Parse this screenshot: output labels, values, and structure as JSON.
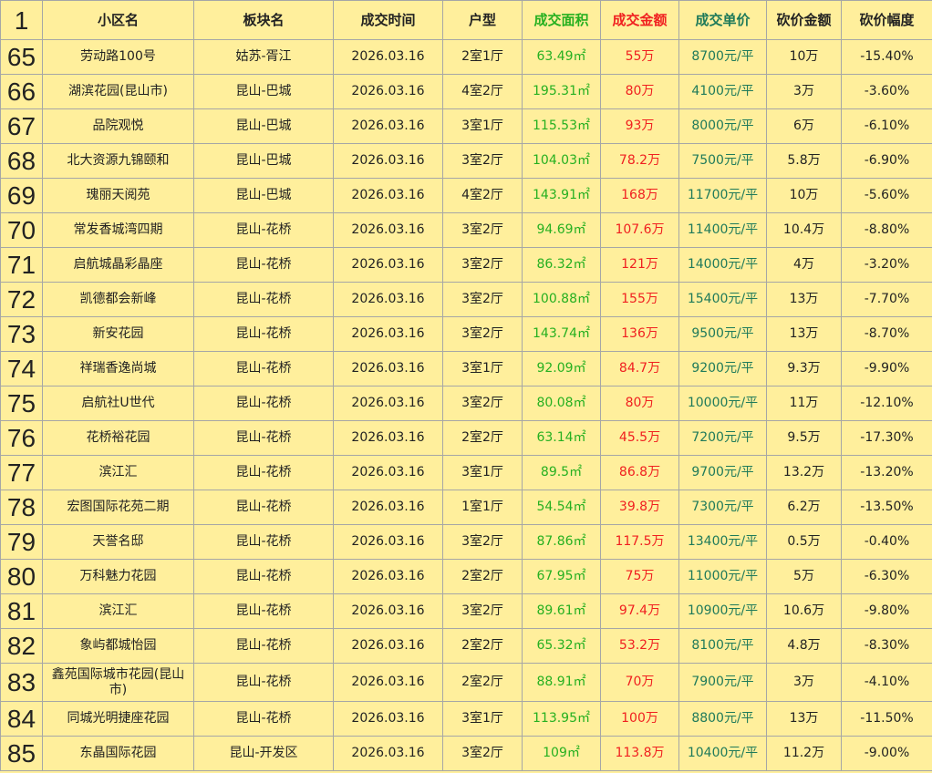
{
  "header": {
    "row_number": "1",
    "columns": [
      "小区名",
      "板块名",
      "成交时间",
      "户型",
      "成交面积",
      "成交金额",
      "成交单价",
      "砍价金额",
      "砍价幅度"
    ]
  },
  "rows": [
    {
      "n": "65",
      "name": "劳动路100号",
      "area": "姑苏-胥江",
      "date": "2026.03.16",
      "layout": "2室1厅",
      "size": "63.49㎡",
      "price": "55万",
      "unit": "8700元/平",
      "cut": "10万",
      "pct": "-15.40%"
    },
    {
      "n": "66",
      "name": "湖滨花园(昆山市)",
      "area": "昆山-巴城",
      "date": "2026.03.16",
      "layout": "4室2厅",
      "size": "195.31㎡",
      "price": "80万",
      "unit": "4100元/平",
      "cut": "3万",
      "pct": "-3.60%"
    },
    {
      "n": "67",
      "name": "品院观悦",
      "area": "昆山-巴城",
      "date": "2026.03.16",
      "layout": "3室1厅",
      "size": "115.53㎡",
      "price": "93万",
      "unit": "8000元/平",
      "cut": "6万",
      "pct": "-6.10%"
    },
    {
      "n": "68",
      "name": "北大资源九锦颐和",
      "area": "昆山-巴城",
      "date": "2026.03.16",
      "layout": "3室2厅",
      "size": "104.03㎡",
      "price": "78.2万",
      "unit": "7500元/平",
      "cut": "5.8万",
      "pct": "-6.90%"
    },
    {
      "n": "69",
      "name": "瑰丽天阅苑",
      "area": "昆山-巴城",
      "date": "2026.03.16",
      "layout": "4室2厅",
      "size": "143.91㎡",
      "price": "168万",
      "unit": "11700元/平",
      "cut": "10万",
      "pct": "-5.60%"
    },
    {
      "n": "70",
      "name": "常发香城湾四期",
      "area": "昆山-花桥",
      "date": "2026.03.16",
      "layout": "3室2厅",
      "size": "94.69㎡",
      "price": "107.6万",
      "unit": "11400元/平",
      "cut": "10.4万",
      "pct": "-8.80%"
    },
    {
      "n": "71",
      "name": "启航城晶彩晶座",
      "area": "昆山-花桥",
      "date": "2026.03.16",
      "layout": "3室2厅",
      "size": "86.32㎡",
      "price": "121万",
      "unit": "14000元/平",
      "cut": "4万",
      "pct": "-3.20%"
    },
    {
      "n": "72",
      "name": "凯德都会新峰",
      "area": "昆山-花桥",
      "date": "2026.03.16",
      "layout": "3室2厅",
      "size": "100.88㎡",
      "price": "155万",
      "unit": "15400元/平",
      "cut": "13万",
      "pct": "-7.70%"
    },
    {
      "n": "73",
      "name": "新安花园",
      "area": "昆山-花桥",
      "date": "2026.03.16",
      "layout": "3室2厅",
      "size": "143.74㎡",
      "price": "136万",
      "unit": "9500元/平",
      "cut": "13万",
      "pct": "-8.70%"
    },
    {
      "n": "74",
      "name": "祥瑞香逸尚城",
      "area": "昆山-花桥",
      "date": "2026.03.16",
      "layout": "3室1厅",
      "size": "92.09㎡",
      "price": "84.7万",
      "unit": "9200元/平",
      "cut": "9.3万",
      "pct": "-9.90%"
    },
    {
      "n": "75",
      "name": "启航社U世代",
      "area": "昆山-花桥",
      "date": "2026.03.16",
      "layout": "3室2厅",
      "size": "80.08㎡",
      "price": "80万",
      "unit": "10000元/平",
      "cut": "11万",
      "pct": "-12.10%"
    },
    {
      "n": "76",
      "name": "花桥裕花园",
      "area": "昆山-花桥",
      "date": "2026.03.16",
      "layout": "2室2厅",
      "size": "63.14㎡",
      "price": "45.5万",
      "unit": "7200元/平",
      "cut": "9.5万",
      "pct": "-17.30%"
    },
    {
      "n": "77",
      "name": "滨江汇",
      "area": "昆山-花桥",
      "date": "2026.03.16",
      "layout": "3室1厅",
      "size": "89.5㎡",
      "price": "86.8万",
      "unit": "9700元/平",
      "cut": "13.2万",
      "pct": "-13.20%"
    },
    {
      "n": "78",
      "name": "宏图国际花苑二期",
      "area": "昆山-花桥",
      "date": "2026.03.16",
      "layout": "1室1厅",
      "size": "54.54㎡",
      "price": "39.8万",
      "unit": "7300元/平",
      "cut": "6.2万",
      "pct": "-13.50%"
    },
    {
      "n": "79",
      "name": "天誉名邸",
      "area": "昆山-花桥",
      "date": "2026.03.16",
      "layout": "3室2厅",
      "size": "87.86㎡",
      "price": "117.5万",
      "unit": "13400元/平",
      "cut": "0.5万",
      "pct": "-0.40%"
    },
    {
      "n": "80",
      "name": "万科魅力花园",
      "area": "昆山-花桥",
      "date": "2026.03.16",
      "layout": "2室2厅",
      "size": "67.95㎡",
      "price": "75万",
      "unit": "11000元/平",
      "cut": "5万",
      "pct": "-6.30%"
    },
    {
      "n": "81",
      "name": "滨江汇",
      "area": "昆山-花桥",
      "date": "2026.03.16",
      "layout": "3室2厅",
      "size": "89.61㎡",
      "price": "97.4万",
      "unit": "10900元/平",
      "cut": "10.6万",
      "pct": "-9.80%"
    },
    {
      "n": "82",
      "name": "象屿都城怡园",
      "area": "昆山-花桥",
      "date": "2026.03.16",
      "layout": "2室2厅",
      "size": "65.32㎡",
      "price": "53.2万",
      "unit": "8100元/平",
      "cut": "4.8万",
      "pct": "-8.30%"
    },
    {
      "n": "83",
      "name": "鑫苑国际城市花园(昆山市)",
      "area": "昆山-花桥",
      "date": "2026.03.16",
      "layout": "2室2厅",
      "size": "88.91㎡",
      "price": "70万",
      "unit": "7900元/平",
      "cut": "3万",
      "pct": "-4.10%"
    },
    {
      "n": "84",
      "name": "同城光明捷座花园",
      "area": "昆山-花桥",
      "date": "2026.03.16",
      "layout": "3室1厅",
      "size": "113.95㎡",
      "price": "100万",
      "unit": "8800元/平",
      "cut": "13万",
      "pct": "-11.50%"
    },
    {
      "n": "85",
      "name": "东晶国际花园",
      "area": "昆山-开发区",
      "date": "2026.03.16",
      "layout": "3室2厅",
      "size": "109㎡",
      "price": "113.8万",
      "unit": "10400元/平",
      "cut": "11.2万",
      "pct": "-9.00%"
    }
  ],
  "colors": {
    "background": "#FFEF9C",
    "gridline": "#A6A6A6",
    "size_column": "#26B020",
    "price_column": "#F02020",
    "unit_price_column": "#1F7A5A"
  }
}
